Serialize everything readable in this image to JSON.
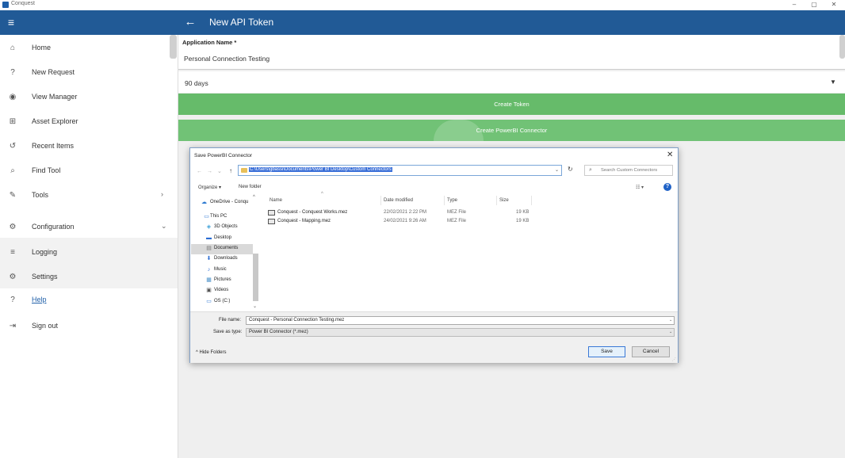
{
  "window": {
    "title": "Conquest",
    "controls": [
      "–",
      "▢",
      "✕"
    ]
  },
  "header": {
    "title": "New API Token"
  },
  "sidebar": {
    "items": [
      {
        "label": "Home",
        "icon": "home-icon",
        "glyph": "⌂"
      },
      {
        "label": "New Request",
        "icon": "help-circle-icon",
        "glyph": "?"
      },
      {
        "label": "View Manager",
        "icon": "eye-icon",
        "glyph": "◉"
      },
      {
        "label": "Asset Explorer",
        "icon": "hierarchy-icon",
        "glyph": "⊞"
      },
      {
        "label": "Recent Items",
        "icon": "history-icon",
        "glyph": "↺"
      },
      {
        "label": "Find Tool",
        "icon": "search-icon",
        "glyph": "⌕"
      },
      {
        "label": "Tools",
        "icon": "wrench-icon",
        "glyph": "✎"
      },
      {
        "label": "Configuration",
        "icon": "gear-icon",
        "glyph": "⚙"
      },
      {
        "label": "Logging",
        "icon": "list-icon",
        "glyph": "≡"
      },
      {
        "label": "Settings",
        "icon": "gear-icon",
        "glyph": "⚙"
      },
      {
        "label": "Help",
        "icon": "help-icon",
        "glyph": "?"
      },
      {
        "label": "Sign out",
        "icon": "sign-out-icon",
        "glyph": "⇥"
      }
    ]
  },
  "form": {
    "app_name_label": "Application Name *",
    "app_name_value": "Personal Connection Testing",
    "duration_value": "90 days",
    "create_token_label": "Create Token",
    "create_pbi_label": "Create PowerBI Connector"
  },
  "dialog": {
    "title": "Save PowerBI Connector",
    "address_path": "C:\\Users\\gbassi\\Documents\\Power BI Desktop\\Custom Connectors",
    "search_placeholder": "Search Custom Connectors",
    "organize_label": "Organize ▾",
    "new_folder_label": "New folder",
    "nav_tree": [
      {
        "label": "OneDrive - Conqu",
        "icon": "cloud-icon",
        "glyph": "☁",
        "color": "#2b78d0",
        "indent": 0
      },
      {
        "label": "This PC",
        "icon": "computer-icon",
        "glyph": "▭",
        "color": "#3b7fd6",
        "indent": 1
      },
      {
        "label": "3D Objects",
        "icon": "cube-icon",
        "glyph": "◈",
        "color": "#3aa0d8",
        "indent": 2
      },
      {
        "label": "Desktop",
        "icon": "desktop-icon",
        "glyph": "▬",
        "color": "#2a6cd3",
        "indent": 2
      },
      {
        "label": "Documents",
        "icon": "document-icon",
        "glyph": "▤",
        "color": "#777777",
        "indent": 2
      },
      {
        "label": "Downloads",
        "icon": "download-icon",
        "glyph": "⬇",
        "color": "#2a6cd3",
        "indent": 2
      },
      {
        "label": "Music",
        "icon": "music-icon",
        "glyph": "♪",
        "color": "#2a6cd3",
        "indent": 2
      },
      {
        "label": "Pictures",
        "icon": "picture-icon",
        "glyph": "▦",
        "color": "#4a90c8",
        "indent": 2
      },
      {
        "label": "Videos",
        "icon": "video-icon",
        "glyph": "▣",
        "color": "#555555",
        "indent": 2
      },
      {
        "label": "OS (C:)",
        "icon": "drive-icon",
        "glyph": "▭",
        "color": "#3b7fd6",
        "indent": 2
      }
    ],
    "columns": {
      "name": "Name",
      "date": "Date modified",
      "type": "Type",
      "size": "Size"
    },
    "files": [
      {
        "name": "Conquest - Conquest Works.mez",
        "date": "22/02/2021 2:22 PM",
        "type": "MEZ File",
        "size": "19 KB"
      },
      {
        "name": "Conquest - Mapping.mez",
        "date": "24/02/2021 9:26 AM",
        "type": "MEZ File",
        "size": "19 KB"
      }
    ],
    "file_name_label": "File name:",
    "file_name_value": "Conquest - Personal Connection Testing.mez",
    "save_type_label": "Save as type:",
    "save_type_value": "Power BI Connector (*.mez)",
    "hide_folders_label": "Hide Folders",
    "save_label": "Save",
    "cancel_label": "Cancel"
  }
}
